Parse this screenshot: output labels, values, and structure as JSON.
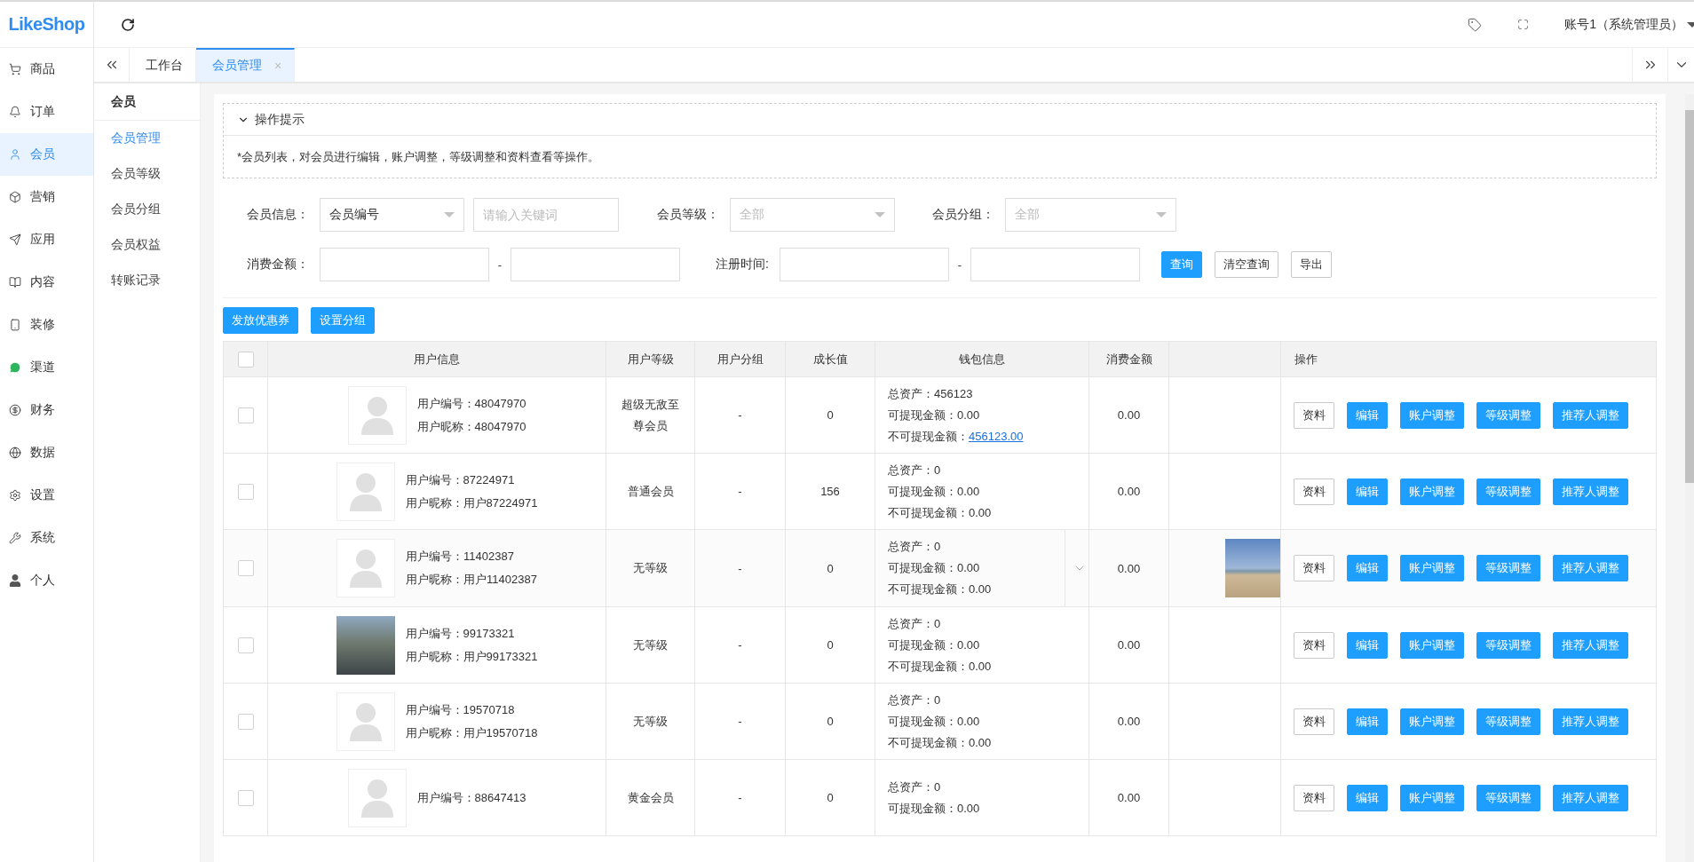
{
  "logo": "LikeShop",
  "sidebar": {
    "items": [
      {
        "label": "商品",
        "selected": false
      },
      {
        "label": "订单",
        "selected": false
      },
      {
        "label": "会员",
        "selected": true
      },
      {
        "label": "营销",
        "selected": false
      },
      {
        "label": "应用",
        "selected": false
      },
      {
        "label": "内容",
        "selected": false
      },
      {
        "label": "装修",
        "selected": false
      },
      {
        "label": "渠道",
        "selected": false
      },
      {
        "label": "财务",
        "selected": false
      },
      {
        "label": "数据",
        "selected": false
      },
      {
        "label": "设置",
        "selected": false
      },
      {
        "label": "系统",
        "selected": false
      },
      {
        "label": "个人",
        "selected": false
      }
    ]
  },
  "topbar": {
    "account": "账号1（系统管理员）"
  },
  "tabs": [
    {
      "label": "工作台",
      "selected": false
    },
    {
      "label": "会员管理",
      "selected": true
    }
  ],
  "close_glyph": "×",
  "subnav": {
    "title": "会员",
    "items": [
      {
        "label": "会员管理",
        "selected": true
      },
      {
        "label": "会员等级",
        "selected": false
      },
      {
        "label": "会员分组",
        "selected": false
      },
      {
        "label": "会员权益",
        "selected": false
      },
      {
        "label": "转账记录",
        "selected": false
      }
    ]
  },
  "tips": {
    "title": "操作提示",
    "expanded": true,
    "text": "*会员列表，对会员进行编辑，账户调整，等级调整和资料查看等操作。"
  },
  "filters": {
    "member_info": {
      "label": "会员信息：",
      "value": "会员编号",
      "keyword_placeholder": "请输入关键词"
    },
    "member_level": {
      "label": "会员等级：",
      "placeholder": "全部"
    },
    "member_group": {
      "label": "会员分组：",
      "placeholder": "全部"
    },
    "amount": {
      "label": "消费金额：",
      "separator": "-"
    },
    "register_time": {
      "label": "注册时间:",
      "separator": "-"
    },
    "buttons": [
      {
        "label": "查询",
        "kind": "primary"
      },
      {
        "label": "清空查询",
        "kind": "plain"
      },
      {
        "label": "导出",
        "kind": "plain"
      }
    ]
  },
  "bulk_actions": [
    "发放优惠券",
    "设置分组"
  ],
  "table": {
    "select_all_checked": false,
    "columns": [
      "用户信息",
      "用户等级",
      "用户分组",
      "成长值",
      "钱包信息",
      "消费金额",
      "操作"
    ],
    "rows": [
      {
        "checked": false,
        "photo_avatar": false,
        "id_line": "用户编号：48047970",
        "nick_line": "用户昵称：48047970",
        "level": "超级无敌至尊会员",
        "group": "-",
        "growth": "0",
        "wallet": [
          {
            "label": "总资产：",
            "value": "456123",
            "link": false
          },
          {
            "label": "可提现金额：",
            "value": "0.00",
            "link": false
          },
          {
            "label": "不可提现金额：",
            "value": "456123.00",
            "link": true
          }
        ],
        "dropdown": false,
        "spent": "0.00",
        "picture": false,
        "actions": [
          {
            "label": "资料",
            "kind": "plain"
          },
          {
            "label": "编辑",
            "kind": "primary"
          },
          {
            "label": "账户调整",
            "kind": "primary"
          },
          {
            "label": "等级调整",
            "kind": "primary"
          },
          {
            "label": "推荐人调整",
            "kind": "primary"
          }
        ]
      },
      {
        "checked": false,
        "photo_avatar": false,
        "id_line": "用户编号：87224971",
        "nick_line": "用户昵称：用户87224971",
        "level": "普通会员",
        "group": "-",
        "growth": "156",
        "wallet": [
          {
            "label": "总资产：",
            "value": "0",
            "link": false
          },
          {
            "label": "可提现金额：",
            "value": "0.00",
            "link": false
          },
          {
            "label": "不可提现金额：",
            "value": "0.00",
            "link": false
          }
        ],
        "dropdown": false,
        "spent": "0.00",
        "picture": false,
        "actions": [
          {
            "label": "资料",
            "kind": "plain"
          },
          {
            "label": "编辑",
            "kind": "primary"
          },
          {
            "label": "账户调整",
            "kind": "primary"
          },
          {
            "label": "等级调整",
            "kind": "primary"
          },
          {
            "label": "推荐人调整",
            "kind": "primary"
          }
        ]
      },
      {
        "checked": false,
        "photo_avatar": false,
        "id_line": "用户编号：11402387",
        "nick_line": "用户昵称：用户11402387",
        "level": "无等级",
        "group": "-",
        "growth": "0",
        "wallet": [
          {
            "label": "总资产：",
            "value": "0",
            "link": false
          },
          {
            "label": "可提现金额：",
            "value": "0.00",
            "link": false
          },
          {
            "label": "不可提现金额：",
            "value": "0.00",
            "link": false
          }
        ],
        "dropdown": true,
        "spent": "0.00",
        "picture": true,
        "actions": [
          {
            "label": "资料",
            "kind": "plain"
          },
          {
            "label": "编辑",
            "kind": "primary"
          },
          {
            "label": "账户调整",
            "kind": "primary"
          },
          {
            "label": "等级调整",
            "kind": "primary"
          },
          {
            "label": "推荐人调整",
            "kind": "primary"
          }
        ]
      },
      {
        "checked": false,
        "photo_avatar": true,
        "id_line": "用户编号：99173321",
        "nick_line": "用户昵称：用户99173321",
        "level": "无等级",
        "group": "-",
        "growth": "0",
        "wallet": [
          {
            "label": "总资产：",
            "value": "0",
            "link": false
          },
          {
            "label": "可提现金额：",
            "value": "0.00",
            "link": false
          },
          {
            "label": "不可提现金额：",
            "value": "0.00",
            "link": false
          }
        ],
        "dropdown": false,
        "spent": "0.00",
        "picture": false,
        "actions": [
          {
            "label": "资料",
            "kind": "plain"
          },
          {
            "label": "编辑",
            "kind": "primary"
          },
          {
            "label": "账户调整",
            "kind": "primary"
          },
          {
            "label": "等级调整",
            "kind": "primary"
          },
          {
            "label": "推荐人调整",
            "kind": "primary"
          }
        ]
      },
      {
        "checked": false,
        "photo_avatar": false,
        "id_line": "用户编号：19570718",
        "nick_line": "用户昵称：用户19570718",
        "level": "无等级",
        "group": "-",
        "growth": "0",
        "wallet": [
          {
            "label": "总资产：",
            "value": "0",
            "link": false
          },
          {
            "label": "可提现金额：",
            "value": "0.00",
            "link": false
          },
          {
            "label": "不可提现金额：",
            "value": "0.00",
            "link": false
          }
        ],
        "dropdown": false,
        "spent": "0.00",
        "picture": false,
        "actions": [
          {
            "label": "资料",
            "kind": "plain"
          },
          {
            "label": "编辑",
            "kind": "primary"
          },
          {
            "label": "账户调整",
            "kind": "primary"
          },
          {
            "label": "等级调整",
            "kind": "primary"
          },
          {
            "label": "推荐人调整",
            "kind": "primary"
          }
        ]
      },
      {
        "checked": false,
        "photo_avatar": false,
        "id_line": "用户编号：88647413",
        "level": "黄金会员",
        "group": "-",
        "growth": "0",
        "wallet": [
          {
            "label": "总资产：",
            "value": "0",
            "link": false
          },
          {
            "label": "可提现金额：",
            "value": "0.00",
            "link": false
          }
        ],
        "dropdown": false,
        "spent": "0.00",
        "picture": false,
        "actions": [
          {
            "label": "资料",
            "kind": "plain"
          },
          {
            "label": "编辑",
            "kind": "primary"
          },
          {
            "label": "账户调整",
            "kind": "primary"
          },
          {
            "label": "等级调整",
            "kind": "primary"
          },
          {
            "label": "推荐人调整",
            "kind": "primary"
          }
        ]
      }
    ]
  }
}
